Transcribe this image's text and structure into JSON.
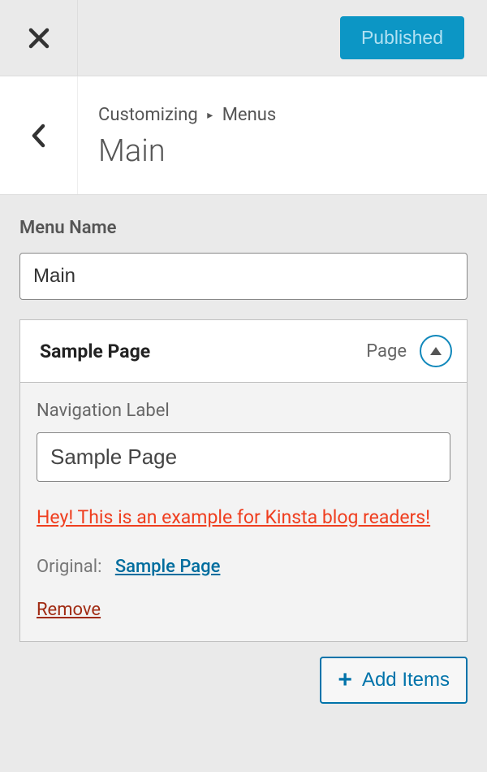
{
  "topbar": {
    "publish_label": "Published"
  },
  "header": {
    "breadcrumb_root": "Customizing",
    "breadcrumb_parent": "Menus",
    "title": "Main"
  },
  "menu_name": {
    "label": "Menu Name",
    "value": "Main"
  },
  "menu_item": {
    "title": "Sample Page",
    "type_label": "Page",
    "nav_label_label": "Navigation Label",
    "nav_label_value": "Sample Page",
    "example_note": "Hey! This is an example for Kinsta blog readers!",
    "original_label": "Original:",
    "original_link": "Sample Page",
    "remove_label": "Remove"
  },
  "actions": {
    "add_items_label": "Add Items"
  },
  "colors": {
    "primary": "#0073aa",
    "publish_bg": "#0c96c5",
    "danger": "#ef3e1f",
    "remove": "#a02a12"
  }
}
